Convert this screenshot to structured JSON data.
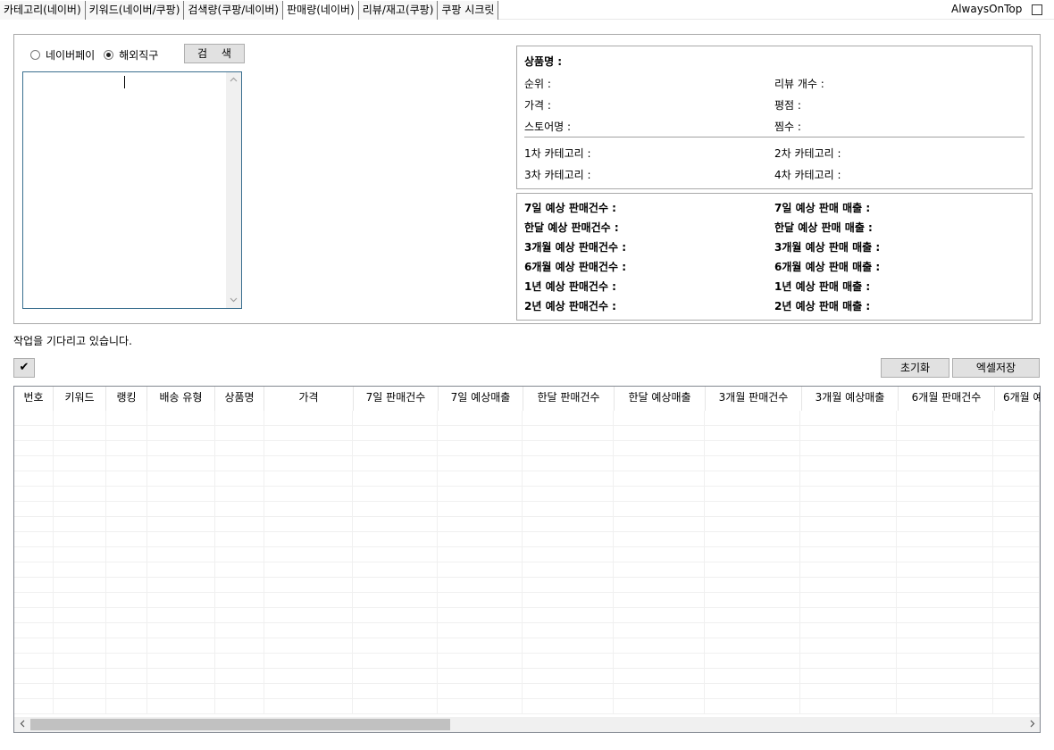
{
  "tabs": [
    {
      "label": "카테고리(네이버)"
    },
    {
      "label": "키워드(네이버/쿠팡)"
    },
    {
      "label": "검색량(쿠팡/네이버)"
    },
    {
      "label": "판매량(네이버)"
    },
    {
      "label": "리뷰/재고(쿠팡)"
    },
    {
      "label": "쿠팡 시크릿"
    }
  ],
  "always_on_top": {
    "label": "AlwaysOnTop",
    "checked": false
  },
  "search": {
    "radio_naverpay": "네이버페이",
    "radio_overseas": "해외직구",
    "selected": "해외직구",
    "button": "검 색",
    "textarea_value": ""
  },
  "info": {
    "product_name": "상품명 :",
    "rank": "순위 :",
    "review_count": "리뷰 개수 :",
    "price": "가격 :",
    "rating": "평점 :",
    "store": "스토어명 :",
    "wishes": "찜수 :",
    "cat1": "1차 카테고리 :",
    "cat2": "2차 카테고리 :",
    "cat3": "3차 카테고리 :",
    "cat4": "4차 카테고리 :"
  },
  "sales": {
    "d7_count": "7일 예상 판매건수 :",
    "d7_revenue": "7일 예상 판매 매출 :",
    "m1_count": "한달 예상 판매건수 :",
    "m1_revenue": "한달 예상 판매 매출 :",
    "m3_count": "3개월 예상 판매건수 :",
    "m3_revenue": "3개월 예상 판매 매출 :",
    "m6_count": "6개월 예상 판매건수 :",
    "m6_revenue": "6개월 예상 판매 매출 :",
    "y1_count": "1년 예상 판매건수 :",
    "y1_revenue": "1년 예상 판매 매출 :",
    "y2_count": "2년 예상 판매건수 :",
    "y2_revenue": "2년 예상 판매 매출 :"
  },
  "status": "작업을 기다리고 있습니다.",
  "buttons": {
    "check": "✔",
    "reset": "초기화",
    "excel": "엑셀저장"
  },
  "grid": {
    "columns": [
      "번호",
      "키워드",
      "랭킹",
      "배송 유형",
      "상품명",
      "가격",
      "7일 판매건수",
      "7일 예상매출",
      "한달 판매건수",
      "한달 예상매출",
      "3개월 판매건수",
      "3개월 예상매출",
      "6개월 판매건수",
      "6개월 예"
    ]
  },
  "icons": {
    "check": "check-icon",
    "scroll_up": "chevron-up-icon",
    "scroll_down": "chevron-down-icon",
    "scroll_left": "chevron-left-icon",
    "scroll_right": "chevron-right-icon"
  }
}
